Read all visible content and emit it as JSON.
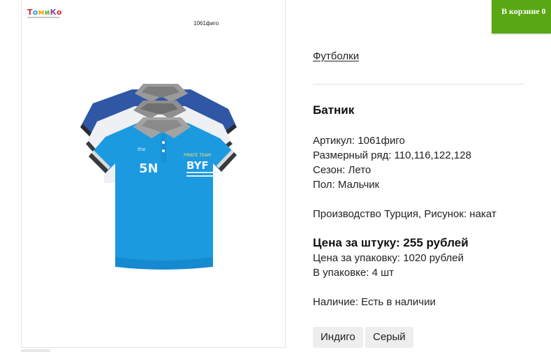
{
  "brand": {
    "logo_letters": [
      "Т",
      "о",
      "м",
      "и",
      "К",
      "о"
    ]
  },
  "photo": {
    "code_label": "1061фиго"
  },
  "cart": {
    "label": "В корзине 0"
  },
  "breadcrumb": {
    "category": "Футболки"
  },
  "product": {
    "title": "Батник",
    "details": [
      "Артикул: 1061фиго",
      "Размерный ряд: 110,116,122,128",
      "Сезон: Лето",
      "Пол: Мальчик"
    ],
    "description": "Производство Турция, Рисунок: накат",
    "price_per_item": "Цена за штуку: 255 рублей",
    "price_per_pack": "Цена за упаковку: 1020 рублей",
    "pack_qty": "В упаковке: 4 шт",
    "availability": "Наличие: Есть в наличии"
  },
  "colors": {
    "options": [
      "Индиго",
      "Серый"
    ]
  },
  "shirt_print": {
    "number": "5N",
    "brand_text": "BYF",
    "team_text": "PIRATE TEAM",
    "small_text": "the"
  },
  "theme": {
    "cart_bg": "#59a713",
    "shirt_front": "#1b9ae0",
    "shirt_back": "#2f57a6",
    "shirt_mid": "#eef0f3",
    "collar": "#9a9a9a"
  }
}
